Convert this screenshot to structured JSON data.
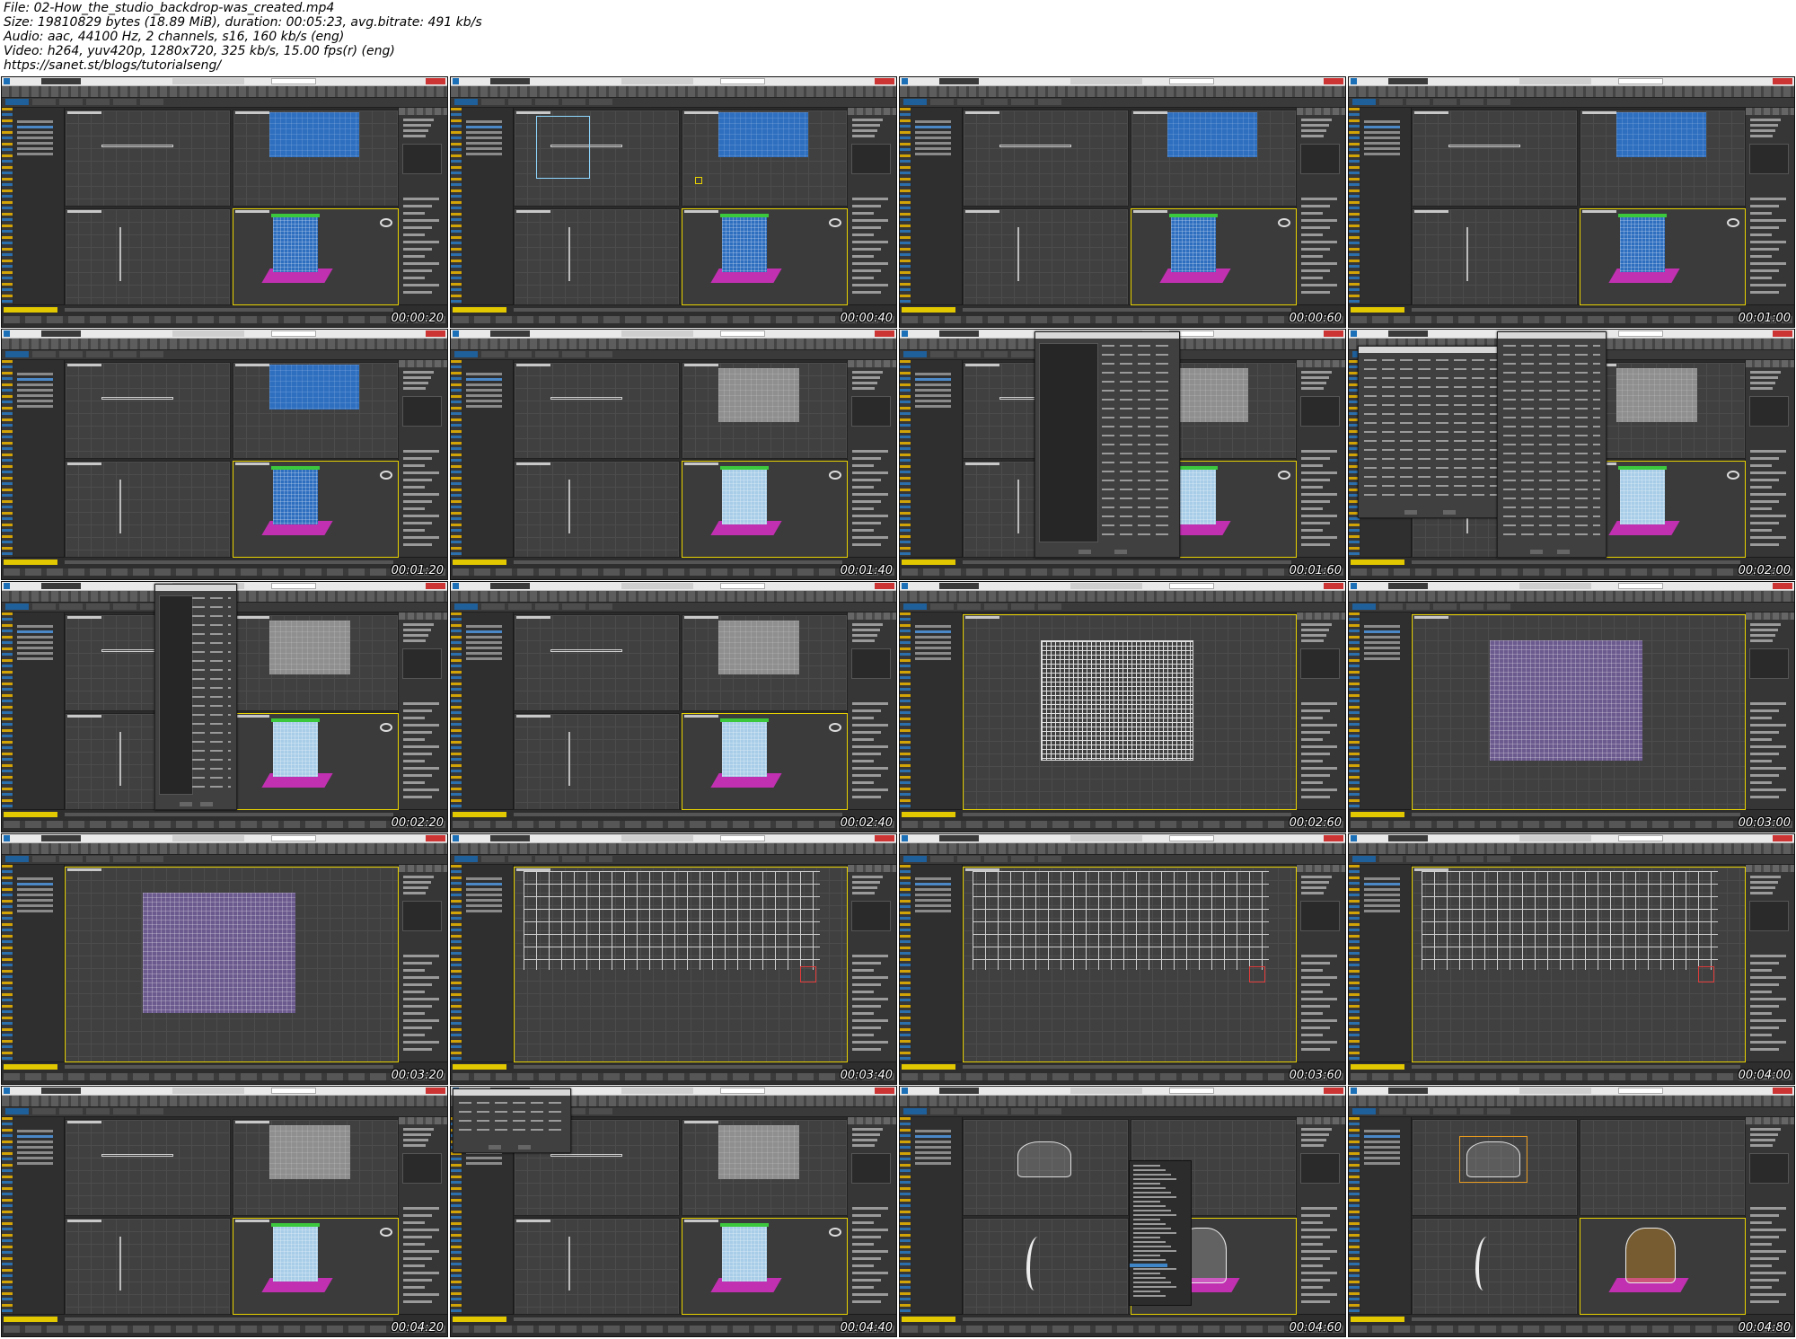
{
  "header": {
    "lines": [
      "File: 02-How_the_studio_backdrop-was_created.mp4",
      "Size: 19810829 bytes (18.89 MiB), duration: 00:05:23, avg.bitrate: 491 kb/s",
      "Audio: aac, 44100 Hz, 2 channels, s16, 160 kb/s (eng)",
      "Video: h264, yuv420p, 1280x720, 325 kb/s, 15.00 fps(r) (eng)",
      "https://sanet.st/blogs/tutorialseng/"
    ]
  },
  "thumbnails": [
    {
      "timestamp": "00:00:20",
      "layout": "quad",
      "scene": "blue-plane"
    },
    {
      "timestamp": "00:00:40",
      "layout": "quad",
      "scene": "selection"
    },
    {
      "timestamp": "00:00:60",
      "layout": "quad",
      "scene": "blue-plane"
    },
    {
      "timestamp": "00:01:00",
      "layout": "quad",
      "scene": "blue-plane"
    },
    {
      "timestamp": "00:01:20",
      "layout": "quad",
      "scene": "blue-plane"
    },
    {
      "timestamp": "00:01:40",
      "layout": "quad",
      "scene": "grey-plane"
    },
    {
      "timestamp": "00:01:60",
      "layout": "quad",
      "scene": "dialog-left"
    },
    {
      "timestamp": "00:02:00",
      "layout": "quad",
      "scene": "dialog-wide"
    },
    {
      "timestamp": "00:02:20",
      "layout": "quad",
      "scene": "dialog-small"
    },
    {
      "timestamp": "00:02:40",
      "layout": "quad",
      "scene": "grey-plane"
    },
    {
      "timestamp": "00:02:60",
      "layout": "single",
      "scene": "white-mesh"
    },
    {
      "timestamp": "00:03:00",
      "layout": "single",
      "scene": "purple-mesh"
    },
    {
      "timestamp": "00:03:20",
      "layout": "single",
      "scene": "purple-mesh"
    },
    {
      "timestamp": "00:03:40",
      "layout": "single",
      "scene": "wide-mesh"
    },
    {
      "timestamp": "00:03:60",
      "layout": "single",
      "scene": "wide-mesh"
    },
    {
      "timestamp": "00:04:00",
      "layout": "single",
      "scene": "wide-mesh"
    },
    {
      "timestamp": "00:04:20",
      "layout": "quad",
      "scene": "grey-plane"
    },
    {
      "timestamp": "00:04:40",
      "layout": "quad",
      "scene": "sim-dialog"
    },
    {
      "timestamp": "00:04:60",
      "layout": "quad",
      "scene": "drape-menu"
    },
    {
      "timestamp": "00:04:80",
      "layout": "quad",
      "scene": "drape-orange"
    }
  ],
  "colors": {
    "ui_dark": "#2b2b2b",
    "viewport": "#3b3b3b",
    "blue_cloth": "#2f6fc0",
    "light_cloth": "#a8cde8",
    "magenta_floor": "#c030b0",
    "green_bar": "#3cc83c",
    "active_border": "#e8d200",
    "selection_blue": "#4a88c7",
    "orange_lattice": "#e69a1e"
  }
}
